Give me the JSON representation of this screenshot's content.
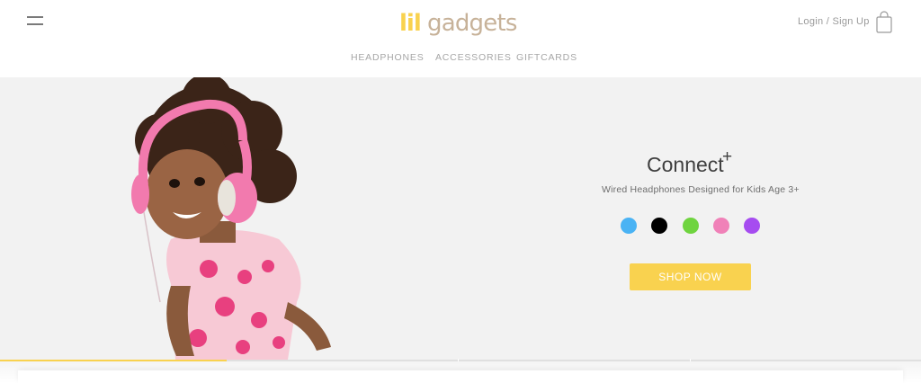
{
  "header": {
    "logo_text": "lilgadgets",
    "login_label": "Login / Sign Up"
  },
  "icons": {
    "menu": "hamburger-menu-icon",
    "bag": "shopping-bag-icon"
  },
  "nav": {
    "items": [
      {
        "label": "HEADPHONES"
      },
      {
        "label": "ACCESSORIES"
      },
      {
        "label": "GIFTCARDS"
      }
    ]
  },
  "hero": {
    "product_name": "Connect",
    "product_superscript": "+",
    "subtitle": "Wired Headphones Designed for Kids Age 3+",
    "cta_label": "SHOP NOW",
    "swatches": [
      {
        "color": "#4ab3f4"
      },
      {
        "color": "#000000"
      },
      {
        "color": "#6fd43f"
      },
      {
        "color": "#f081b8"
      },
      {
        "color": "#a64cf0"
      }
    ],
    "slide_count": 4,
    "active_slide": 1
  },
  "colors": {
    "accent_yellow": "#f9d24f",
    "logo_tan": "#c7b299",
    "hero_background": "#f2f2f2"
  }
}
